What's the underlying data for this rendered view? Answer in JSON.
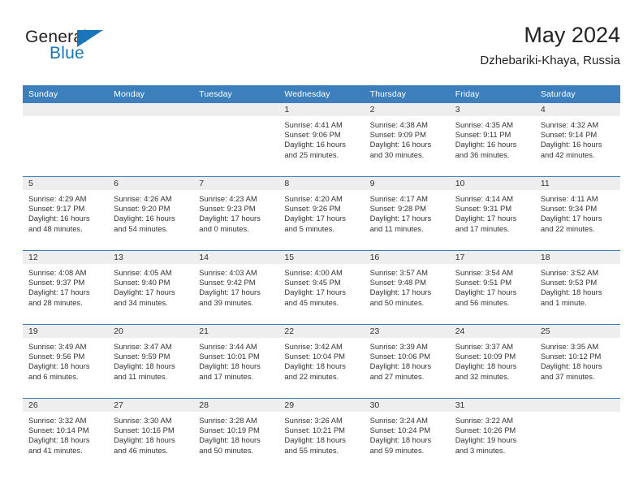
{
  "brand": {
    "name_top": "General",
    "name_bottom": "Blue",
    "triangle_icon": "triangle-icon",
    "color_dark": "#231f20",
    "color_blue": "#1b75bb"
  },
  "header": {
    "title": "May 2024",
    "subtitle": "Dzhebariki-Khaya, Russia"
  },
  "theme": {
    "header_row_bg": "#3d7ebd",
    "daynum_bg": "#eeeeee",
    "grid_line": "#3d7ebd",
    "text": "#333333"
  },
  "weekdays": [
    "Sunday",
    "Monday",
    "Tuesday",
    "Wednesday",
    "Thursday",
    "Friday",
    "Saturday"
  ],
  "weeks": [
    [
      {
        "day": "",
        "sunrise": "",
        "sunset": "",
        "daylight": "",
        "daylight2": ""
      },
      {
        "day": "",
        "sunrise": "",
        "sunset": "",
        "daylight": "",
        "daylight2": ""
      },
      {
        "day": "",
        "sunrise": "",
        "sunset": "",
        "daylight": "",
        "daylight2": ""
      },
      {
        "day": "1",
        "sunrise": "Sunrise: 4:41 AM",
        "sunset": "Sunset: 9:06 PM",
        "daylight": "Daylight: 16 hours",
        "daylight2": "and 25 minutes."
      },
      {
        "day": "2",
        "sunrise": "Sunrise: 4:38 AM",
        "sunset": "Sunset: 9:09 PM",
        "daylight": "Daylight: 16 hours",
        "daylight2": "and 30 minutes."
      },
      {
        "day": "3",
        "sunrise": "Sunrise: 4:35 AM",
        "sunset": "Sunset: 9:11 PM",
        "daylight": "Daylight: 16 hours",
        "daylight2": "and 36 minutes."
      },
      {
        "day": "4",
        "sunrise": "Sunrise: 4:32 AM",
        "sunset": "Sunset: 9:14 PM",
        "daylight": "Daylight: 16 hours",
        "daylight2": "and 42 minutes."
      }
    ],
    [
      {
        "day": "5",
        "sunrise": "Sunrise: 4:29 AM",
        "sunset": "Sunset: 9:17 PM",
        "daylight": "Daylight: 16 hours",
        "daylight2": "and 48 minutes."
      },
      {
        "day": "6",
        "sunrise": "Sunrise: 4:26 AM",
        "sunset": "Sunset: 9:20 PM",
        "daylight": "Daylight: 16 hours",
        "daylight2": "and 54 minutes."
      },
      {
        "day": "7",
        "sunrise": "Sunrise: 4:23 AM",
        "sunset": "Sunset: 9:23 PM",
        "daylight": "Daylight: 17 hours",
        "daylight2": "and 0 minutes."
      },
      {
        "day": "8",
        "sunrise": "Sunrise: 4:20 AM",
        "sunset": "Sunset: 9:26 PM",
        "daylight": "Daylight: 17 hours",
        "daylight2": "and 5 minutes."
      },
      {
        "day": "9",
        "sunrise": "Sunrise: 4:17 AM",
        "sunset": "Sunset: 9:28 PM",
        "daylight": "Daylight: 17 hours",
        "daylight2": "and 11 minutes."
      },
      {
        "day": "10",
        "sunrise": "Sunrise: 4:14 AM",
        "sunset": "Sunset: 9:31 PM",
        "daylight": "Daylight: 17 hours",
        "daylight2": "and 17 minutes."
      },
      {
        "day": "11",
        "sunrise": "Sunrise: 4:11 AM",
        "sunset": "Sunset: 9:34 PM",
        "daylight": "Daylight: 17 hours",
        "daylight2": "and 22 minutes."
      }
    ],
    [
      {
        "day": "12",
        "sunrise": "Sunrise: 4:08 AM",
        "sunset": "Sunset: 9:37 PM",
        "daylight": "Daylight: 17 hours",
        "daylight2": "and 28 minutes."
      },
      {
        "day": "13",
        "sunrise": "Sunrise: 4:05 AM",
        "sunset": "Sunset: 9:40 PM",
        "daylight": "Daylight: 17 hours",
        "daylight2": "and 34 minutes."
      },
      {
        "day": "14",
        "sunrise": "Sunrise: 4:03 AM",
        "sunset": "Sunset: 9:42 PM",
        "daylight": "Daylight: 17 hours",
        "daylight2": "and 39 minutes."
      },
      {
        "day": "15",
        "sunrise": "Sunrise: 4:00 AM",
        "sunset": "Sunset: 9:45 PM",
        "daylight": "Daylight: 17 hours",
        "daylight2": "and 45 minutes."
      },
      {
        "day": "16",
        "sunrise": "Sunrise: 3:57 AM",
        "sunset": "Sunset: 9:48 PM",
        "daylight": "Daylight: 17 hours",
        "daylight2": "and 50 minutes."
      },
      {
        "day": "17",
        "sunrise": "Sunrise: 3:54 AM",
        "sunset": "Sunset: 9:51 PM",
        "daylight": "Daylight: 17 hours",
        "daylight2": "and 56 minutes."
      },
      {
        "day": "18",
        "sunrise": "Sunrise: 3:52 AM",
        "sunset": "Sunset: 9:53 PM",
        "daylight": "Daylight: 18 hours",
        "daylight2": "and 1 minute."
      }
    ],
    [
      {
        "day": "19",
        "sunrise": "Sunrise: 3:49 AM",
        "sunset": "Sunset: 9:56 PM",
        "daylight": "Daylight: 18 hours",
        "daylight2": "and 6 minutes."
      },
      {
        "day": "20",
        "sunrise": "Sunrise: 3:47 AM",
        "sunset": "Sunset: 9:59 PM",
        "daylight": "Daylight: 18 hours",
        "daylight2": "and 11 minutes."
      },
      {
        "day": "21",
        "sunrise": "Sunrise: 3:44 AM",
        "sunset": "Sunset: 10:01 PM",
        "daylight": "Daylight: 18 hours",
        "daylight2": "and 17 minutes."
      },
      {
        "day": "22",
        "sunrise": "Sunrise: 3:42 AM",
        "sunset": "Sunset: 10:04 PM",
        "daylight": "Daylight: 18 hours",
        "daylight2": "and 22 minutes."
      },
      {
        "day": "23",
        "sunrise": "Sunrise: 3:39 AM",
        "sunset": "Sunset: 10:06 PM",
        "daylight": "Daylight: 18 hours",
        "daylight2": "and 27 minutes."
      },
      {
        "day": "24",
        "sunrise": "Sunrise: 3:37 AM",
        "sunset": "Sunset: 10:09 PM",
        "daylight": "Daylight: 18 hours",
        "daylight2": "and 32 minutes."
      },
      {
        "day": "25",
        "sunrise": "Sunrise: 3:35 AM",
        "sunset": "Sunset: 10:12 PM",
        "daylight": "Daylight: 18 hours",
        "daylight2": "and 37 minutes."
      }
    ],
    [
      {
        "day": "26",
        "sunrise": "Sunrise: 3:32 AM",
        "sunset": "Sunset: 10:14 PM",
        "daylight": "Daylight: 18 hours",
        "daylight2": "and 41 minutes."
      },
      {
        "day": "27",
        "sunrise": "Sunrise: 3:30 AM",
        "sunset": "Sunset: 10:16 PM",
        "daylight": "Daylight: 18 hours",
        "daylight2": "and 46 minutes."
      },
      {
        "day": "28",
        "sunrise": "Sunrise: 3:28 AM",
        "sunset": "Sunset: 10:19 PM",
        "daylight": "Daylight: 18 hours",
        "daylight2": "and 50 minutes."
      },
      {
        "day": "29",
        "sunrise": "Sunrise: 3:26 AM",
        "sunset": "Sunset: 10:21 PM",
        "daylight": "Daylight: 18 hours",
        "daylight2": "and 55 minutes."
      },
      {
        "day": "30",
        "sunrise": "Sunrise: 3:24 AM",
        "sunset": "Sunset: 10:24 PM",
        "daylight": "Daylight: 18 hours",
        "daylight2": "and 59 minutes."
      },
      {
        "day": "31",
        "sunrise": "Sunrise: 3:22 AM",
        "sunset": "Sunset: 10:26 PM",
        "daylight": "Daylight: 19 hours",
        "daylight2": "and 3 minutes."
      },
      {
        "day": "",
        "sunrise": "",
        "sunset": "",
        "daylight": "",
        "daylight2": ""
      }
    ]
  ]
}
